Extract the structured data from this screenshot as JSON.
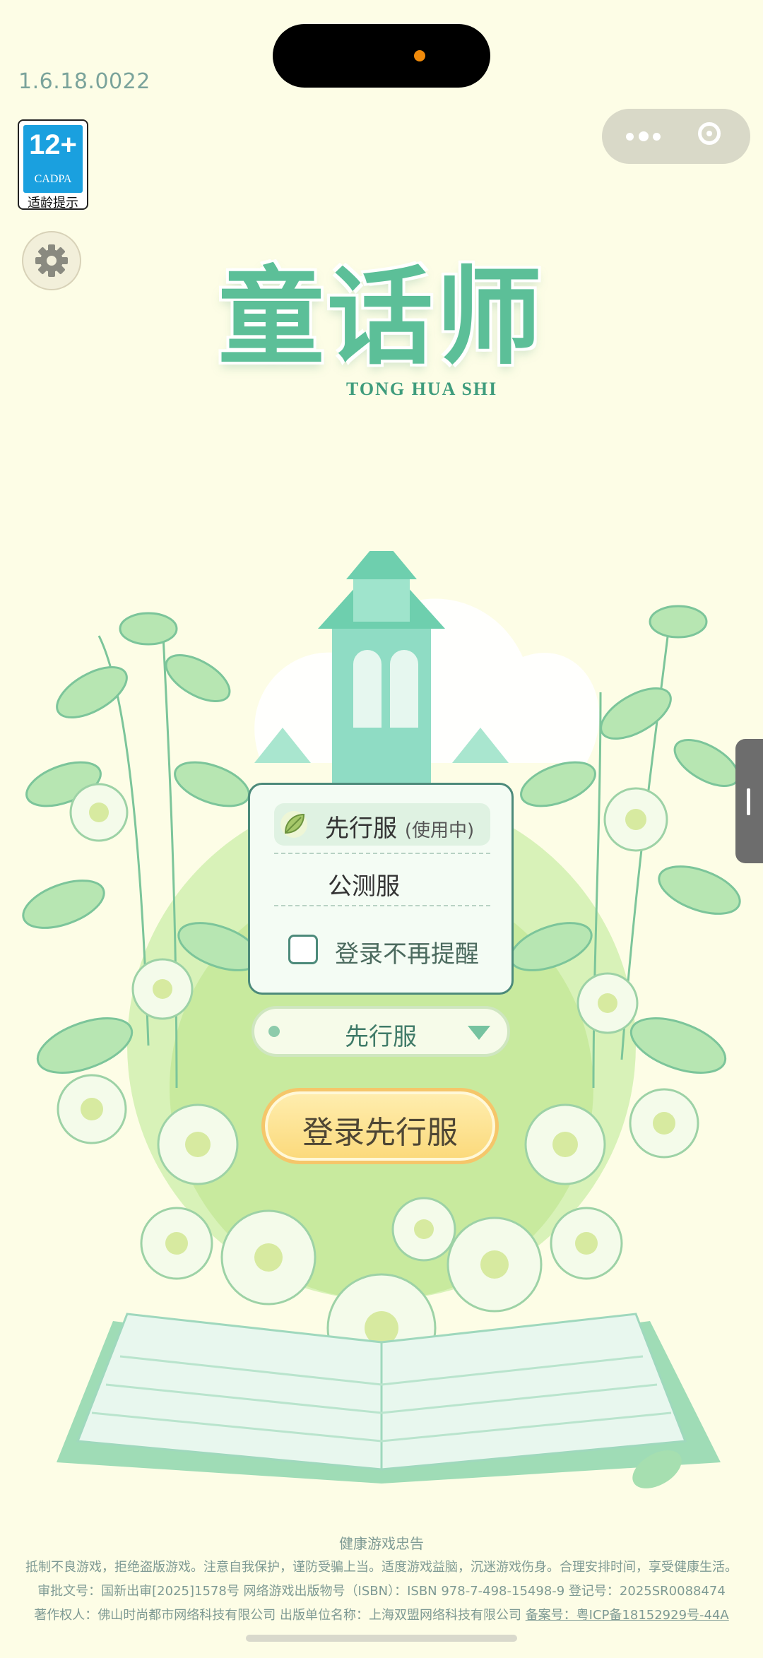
{
  "version": "1.6.18.0022",
  "age_badge": {
    "rating": "12+",
    "org": "CADPA",
    "tip": "适龄提示"
  },
  "logo": {
    "title": "童话师",
    "subtitle": "TONG HUA SHI"
  },
  "server_panel": {
    "selected_option": {
      "label": "先行服",
      "status": "(使用中)"
    },
    "other_option": "公测服",
    "remember_label": "登录不再提醒"
  },
  "dropdown": {
    "selected": "先行服"
  },
  "login_button": "登录先行服",
  "footer": {
    "heading": "健康游戏忠告",
    "advice": "抵制不良游戏，拒绝盗版游戏。注意自我保护，谨防受骗上当。适度游戏益脑，沉迷游戏伤身。合理安排时间，享受健康生活。",
    "approval": "审批文号：国新出审[2025]1578号  网络游戏出版物号（ISBN）：ISBN 978-7-498-15498-9  登记号：2025SR0088474",
    "copyright_prefix": "著作权人：佛山时尚都市网络科技有限公司  出版单位名称：上海双盟网络科技有限公司 ",
    "icp": "备案号：粤ICP备18152929号-44A"
  },
  "colors": {
    "background": "#fdfde6",
    "accent": "#5cbf98",
    "button": "#fbd97a"
  },
  "icons": [
    "menu-dots-icon",
    "close-target-icon",
    "settings-gear-icon",
    "leaf-icon",
    "chevron-down-icon"
  ]
}
